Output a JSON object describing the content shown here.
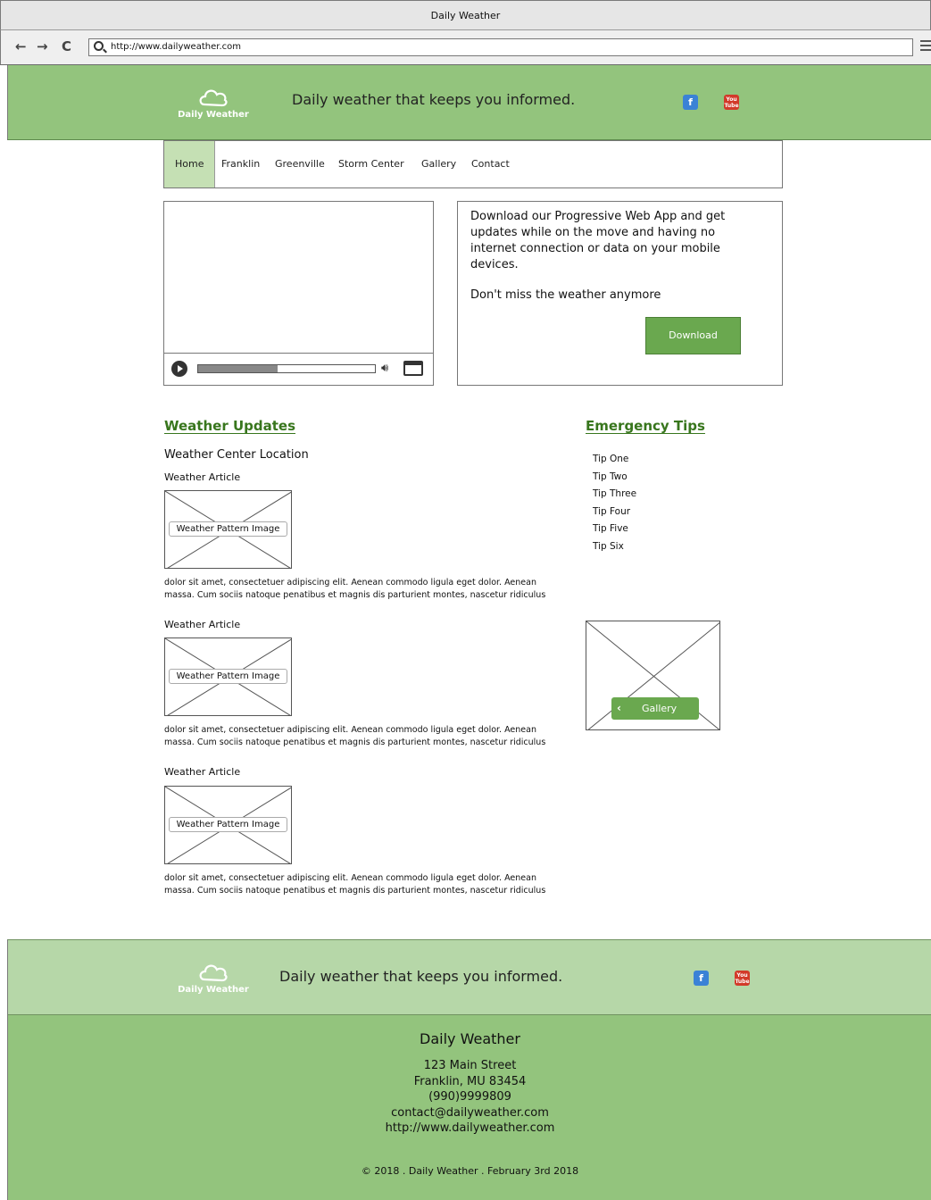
{
  "browser": {
    "window_title": "Daily Weather",
    "url": "http://www.dailyweather.com",
    "back_label": "←",
    "forward_label": "→",
    "reload_label": "C"
  },
  "header": {
    "logo_text": "Daily Weather",
    "tagline": "Daily weather that keeps you informed.",
    "facebook_label": "f",
    "youtube_label": "You Tube"
  },
  "nav": {
    "items": [
      "Home",
      "Franklin",
      "Greenville",
      "Storm Center",
      "Gallery",
      "Contact"
    ]
  },
  "video": {
    "progress": 0.45
  },
  "pwa": {
    "text": "Download our Progressive Web App and get updates while on the move and having no internet connection or data on your mobile devices.",
    "text2": "Don't miss the weather anymore",
    "button": "Download"
  },
  "updates": {
    "heading": "Weather Updates",
    "location": "Weather Center Location",
    "articles": [
      {
        "title": "Weather Article",
        "image_label": "Weather Pattern Image",
        "body": "dolor sit amet, consectetuer adipiscing elit. Aenean commodo ligula eget dolor. Aenean massa. Cum sociis natoque penatibus et magnis dis parturient montes, nascetur ridiculus mus."
      },
      {
        "title": "Weather Article",
        "image_label": "Weather Pattern Image",
        "body": "dolor sit amet, consectetuer adipiscing elit. Aenean commodo ligula eget dolor. Aenean massa. Cum sociis natoque penatibus et magnis dis parturient montes, nascetur ridiculus mus."
      },
      {
        "title": "Weather Article",
        "image_label": "Weather Pattern Image",
        "body": "dolor sit amet, consectetuer adipiscing elit. Aenean commodo ligula eget dolor. Aenean massa. Cum sociis natoque penatibus et magnis dis parturient montes, nascetur ridiculus mus."
      }
    ]
  },
  "tips": {
    "heading": "Emergency Tips",
    "items": [
      "Tip One",
      "Tip Two",
      "Tip Three",
      "Tip Four",
      "Tip Five",
      "Tip Six"
    ]
  },
  "gallery": {
    "button": "Gallery",
    "chevron": "‹"
  },
  "footer": {
    "logo_text": "Daily Weather",
    "tagline": "Daily weather that keeps you informed.",
    "facebook_label": "f",
    "youtube_label": "You Tube",
    "company": "Daily Weather",
    "address1": "123 Main Street",
    "address2": "Franklin, MU 83454",
    "phone": "(990)9999809",
    "email": "contact@dailyweather.com",
    "website": "http://www.dailyweather.com",
    "copyright": "© 2018 . Daily Weather . February 3rd 2018"
  },
  "colors": {
    "header_green": "#93c47d",
    "footer_light_green": "#b6d7a8",
    "button_green": "#6aa84f",
    "heading_green": "#38761d",
    "active_nav": "#c5e0b4"
  }
}
